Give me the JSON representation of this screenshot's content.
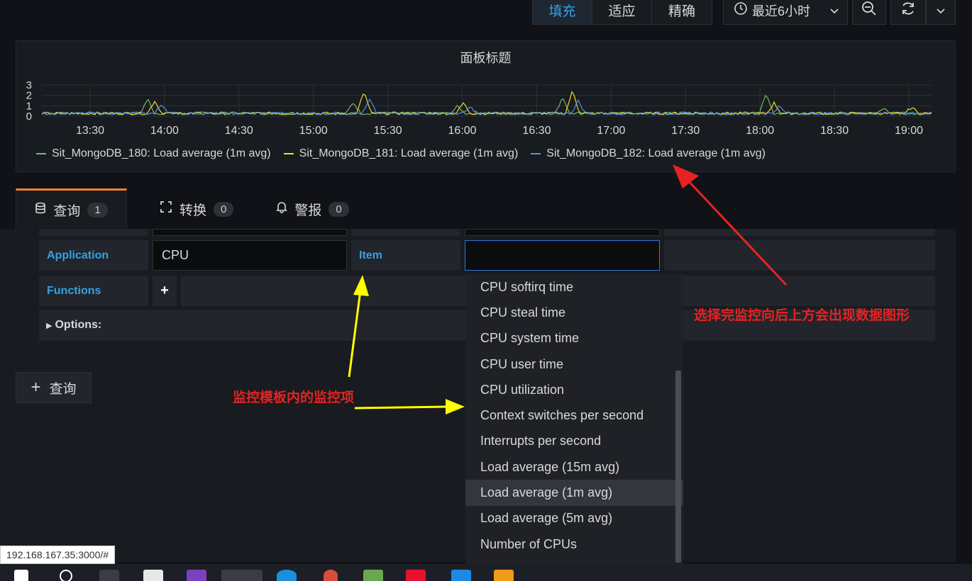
{
  "toolbar": {
    "fit_options": [
      "填充",
      "适应",
      "精确"
    ],
    "active_fit": "填充",
    "time_range": "最近6小时"
  },
  "panel": {
    "title": "面板标题",
    "y_ticks": [
      "3",
      "2",
      "1",
      "0"
    ],
    "x_ticks": [
      "13:30",
      "14:00",
      "14:30",
      "15:00",
      "15:30",
      "16:00",
      "16:30",
      "17:00",
      "17:30",
      "18:00",
      "18:30",
      "19:00"
    ],
    "legend": [
      {
        "name": "Sit_MongoDB_180: Load average (1m avg)",
        "color": "#73bf69"
      },
      {
        "name": "Sit_MongoDB_181: Load average (1m avg)",
        "color": "#fade2a"
      },
      {
        "name": "Sit_MongoDB_182: Load average (1m avg)",
        "color": "#5794f2"
      }
    ]
  },
  "tabs": [
    {
      "label": "查询",
      "count": "1",
      "icon": "database-icon"
    },
    {
      "label": "转换",
      "count": "0",
      "icon": "transform-icon"
    },
    {
      "label": "警报",
      "count": "0",
      "icon": "bell-icon"
    }
  ],
  "query": {
    "application_label": "Application",
    "application_value": "CPU",
    "item_label": "Item",
    "item_value": "",
    "functions_label": "Functions",
    "options_label": "Options:",
    "add_query_label": "查询"
  },
  "dropdown": {
    "options": [
      "CPU softirq time",
      "CPU steal time",
      "CPU system time",
      "CPU user time",
      "CPU utilization",
      "Context switches per second",
      "Interrupts per second",
      "Load average (15m avg)",
      "Load average (1m avg)",
      "Load average (5m avg)",
      "Number of CPUs"
    ],
    "selected": "Load average (1m avg)"
  },
  "annotations": {
    "right": "选择完监控向后上方会出现数据图形",
    "center": "监控模板内的监控项"
  },
  "status_url": "192.168.167.35:3000/#"
}
